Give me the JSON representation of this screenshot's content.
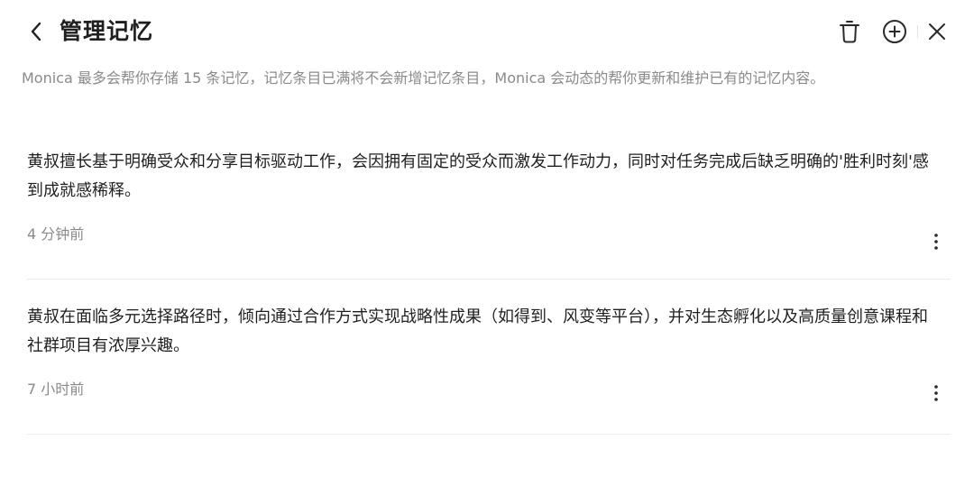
{
  "header": {
    "title": "管理记忆",
    "icons": [
      "chevron-left-icon",
      "trash-icon",
      "plus-circle-icon",
      "close-icon"
    ]
  },
  "description": "Monica 最多会帮你存储 15 条记忆，记忆条目已满将不会新增记忆条目，Monica 会动态的帮你更新和维护已有的记忆内容。",
  "memories": [
    {
      "text": "黄叔擅长基于明确受众和分享目标驱动工作，会因拥有固定的受众而激发工作动力，同时对任务完成后缺乏明确的'胜利时刻'感到成就感稀释。",
      "time": "4 分钟前"
    },
    {
      "text": "黄叔在面临多元选择路径时，倾向通过合作方式实现战略性成果（如得到、风变等平台），并对生态孵化以及高质量创意课程和社群项目有浓厚兴趣。",
      "time": "7 小时前"
    }
  ]
}
